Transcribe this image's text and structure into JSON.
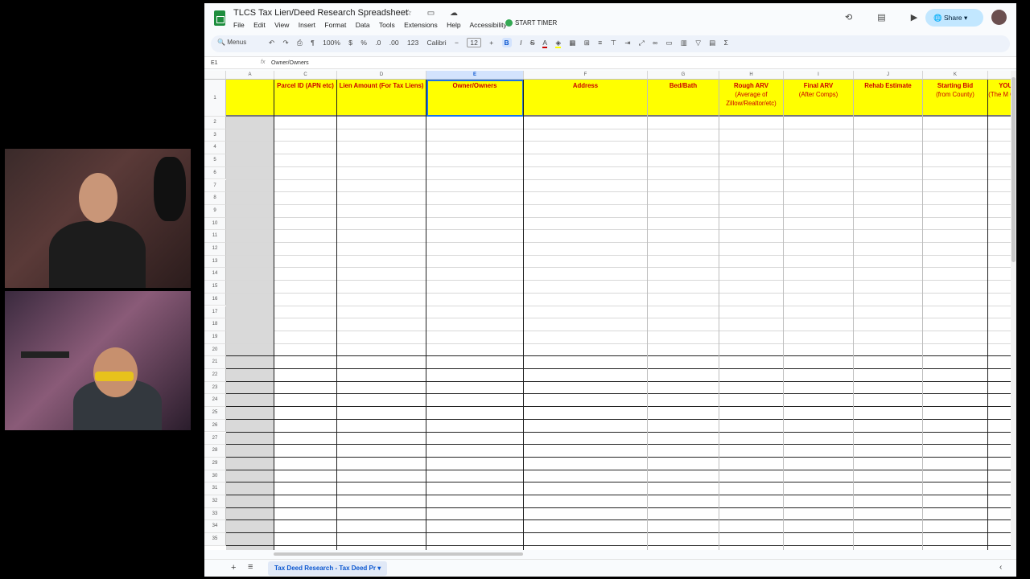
{
  "doc": {
    "title": "TLCS Tax Lien/Deed Research Spreadsheet",
    "title_icons": "☆ ▭ ☁",
    "menus": [
      "File",
      "Edit",
      "View",
      "Insert",
      "Format",
      "Data",
      "Tools",
      "Extensions",
      "Help",
      "Accessibility"
    ],
    "timer_label": "START TIMER",
    "share_label": "Share"
  },
  "toolbar": {
    "search_label": "Menus",
    "zoom": "100%",
    "currency": "$",
    "percent": "%",
    "dec_decrease": ".0",
    "dec_increase": ".00",
    "number_format": "123",
    "font": "Calibri",
    "font_size": "12",
    "bold": "B",
    "italic": "I",
    "strike": "S",
    "text_color": "A"
  },
  "formula": {
    "cell_ref": "E1",
    "fx": "fx",
    "value": "Owner/Owners"
  },
  "columns": [
    {
      "letter": "A",
      "header": "",
      "sub": ""
    },
    {
      "letter": "C",
      "header": "Parcel ID (APN etc)",
      "sub": ""
    },
    {
      "letter": "D",
      "header": "Lien Amount (For Tax Liens)",
      "sub": ""
    },
    {
      "letter": "E",
      "header": "Owner/Owners",
      "sub": ""
    },
    {
      "letter": "F",
      "header": "Address",
      "sub": ""
    },
    {
      "letter": "G",
      "header": "Bed/Bath",
      "sub": ""
    },
    {
      "letter": "H",
      "header": "Rough ARV",
      "sub": "(Average of Zillow/Realtor/etc)"
    },
    {
      "letter": "I",
      "header": "Final ARV",
      "sub": "(After Comps)"
    },
    {
      "letter": "J",
      "header": "Rehab Estimate",
      "sub": ""
    },
    {
      "letter": "K",
      "header": "Starting Bid",
      "sub": "(from County)"
    },
    {
      "letter": "",
      "header": "YOUR",
      "sub": "(The M On Th"
    }
  ],
  "rows": [
    "1",
    "2",
    "3",
    "4",
    "5",
    "6",
    "7",
    "8",
    "9",
    "10",
    "11",
    "12",
    "13",
    "14",
    "15",
    "16",
    "17",
    "18",
    "19",
    "20",
    "21",
    "22",
    "23",
    "24",
    "25",
    "26",
    "27",
    "28",
    "29",
    "30",
    "31",
    "32",
    "33",
    "34",
    "35"
  ],
  "sheet_tab": "Tax Deed Research - Tax Deed Pr",
  "colors": {
    "header_fill": "#ffff00",
    "header_text": "#cc0000",
    "accent": "#1a73e8"
  }
}
